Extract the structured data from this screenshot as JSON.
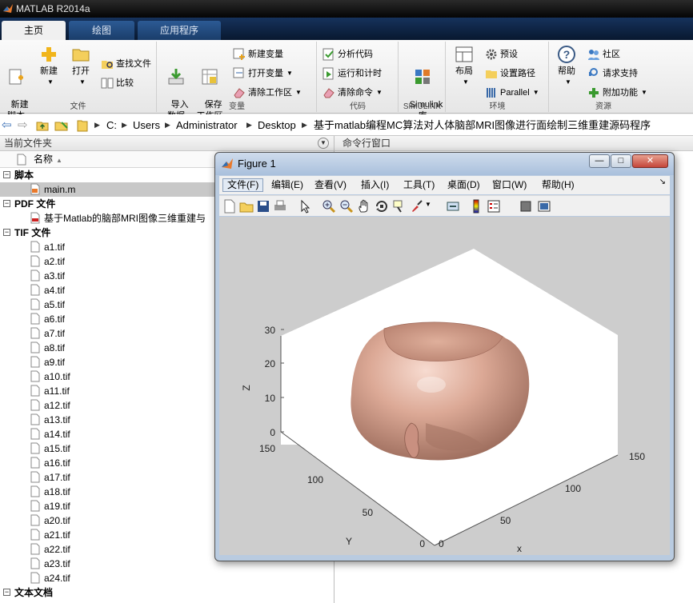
{
  "app": {
    "title": "MATLAB R2014a"
  },
  "ribbon_tabs": [
    {
      "label": "主页",
      "active": true
    },
    {
      "label": "绘图"
    },
    {
      "label": "应用程序"
    }
  ],
  "ribbon": {
    "file": {
      "name": "文件",
      "new_script": "新建\n脚本",
      "new": "新建",
      "open": "打开",
      "find_files": "查找文件",
      "compare": "比较"
    },
    "variable": {
      "name": "变量",
      "import": "导入\n数据",
      "save": "保存\n工作区",
      "new_var": "新建变量",
      "open_var": "打开变量",
      "clear_ws": "清除工作区"
    },
    "code": {
      "name": "代码",
      "analyze": "分析代码",
      "run_time": "运行和计时",
      "clear_cmd": "清除命令"
    },
    "simulink": {
      "name": "SIMULINK",
      "lib": "Simulink\n库"
    },
    "environment": {
      "name": "环境",
      "layout": "布局",
      "prefs": "预设",
      "set_path": "设置路径",
      "parallel": "Parallel"
    },
    "resources": {
      "name": "资源",
      "help": "帮助",
      "community": "社区",
      "request_support": "请求支持",
      "addons": "附加功能"
    }
  },
  "address": {
    "crumbs": [
      "C:",
      "Users",
      "Administrator",
      "Desktop",
      "基于matlab编程MC算法对人体脑部MRI图像进行面绘制三维重建源码程序"
    ]
  },
  "current_folder": {
    "title": "当前文件夹",
    "col_name": "名称",
    "groups": [
      {
        "label": "脚本",
        "files": [
          "main.m"
        ]
      },
      {
        "label": "PDF 文件",
        "files": [
          "基于Matlab的脑部MRI图像三维重建与"
        ]
      },
      {
        "label": "TIF 文件",
        "files": [
          "a1.tif",
          "a2.tif",
          "a3.tif",
          "a4.tif",
          "a5.tif",
          "a6.tif",
          "a7.tif",
          "a8.tif",
          "a9.tif",
          "a10.tif",
          "a11.tif",
          "a12.tif",
          "a13.tif",
          "a14.tif",
          "a15.tif",
          "a16.tif",
          "a17.tif",
          "a18.tif",
          "a19.tif",
          "a20.tif",
          "a21.tif",
          "a22.tif",
          "a23.tif",
          "a24.tif"
        ]
      },
      {
        "label": "文本文档",
        "files": []
      }
    ]
  },
  "command_window": {
    "title": "命令行窗口"
  },
  "figure": {
    "title": "Figure 1",
    "menus": [
      "文件(F)",
      "编辑(E)",
      "查看(V)",
      "插入(I)",
      "工具(T)",
      "桌面(D)",
      "窗口(W)",
      "帮助(H)"
    ],
    "win_buttons": [
      "—",
      "□",
      "✕"
    ],
    "axes": {
      "z_label": "Z",
      "y_label": "Y",
      "x_label": "x",
      "z_ticks": [
        "0",
        "10",
        "20",
        "30"
      ],
      "y_ticks": [
        "0",
        "50",
        "100",
        "150"
      ],
      "x_ticks": [
        "0",
        "50",
        "100",
        "150"
      ]
    },
    "surface_color": "#d7a897"
  },
  "colors": {
    "accent_tab": "#1a3d6a",
    "title_bar": "#111111"
  }
}
